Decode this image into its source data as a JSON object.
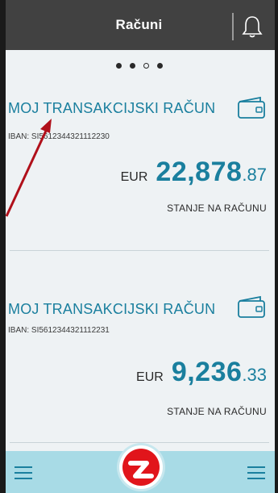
{
  "header": {
    "title": "Računi",
    "bell_icon": "bell-icon"
  },
  "pager": {
    "total": 4,
    "active_index": 2
  },
  "accounts": [
    {
      "name": "MOJ TRANSAKCIJSKI RAČUN",
      "iban_label": "IBAN:",
      "iban": "SI5612344321112230",
      "currency": "EUR",
      "amount_int": "22,878",
      "amount_dec": ".87",
      "balance_label": "STANJE NA RAČUNU"
    },
    {
      "name": "MOJ TRANSAKCIJSKI RAČUN",
      "iban_label": "IBAN:",
      "iban": "SI5612344321112231",
      "currency": "EUR",
      "amount_int": "9,236",
      "amount_dec": ".33",
      "balance_label": "STANJE NA RAČUNU"
    }
  ],
  "bottom_bar": {
    "left_icon": "menu-icon",
    "center_icon": "bank-logo-icon",
    "right_icon": "menu-icon"
  },
  "colors": {
    "accent": "#1a7f9e",
    "header": "#414141",
    "bottom_bar": "#a8dbe6",
    "annotation": "#b0101a"
  }
}
